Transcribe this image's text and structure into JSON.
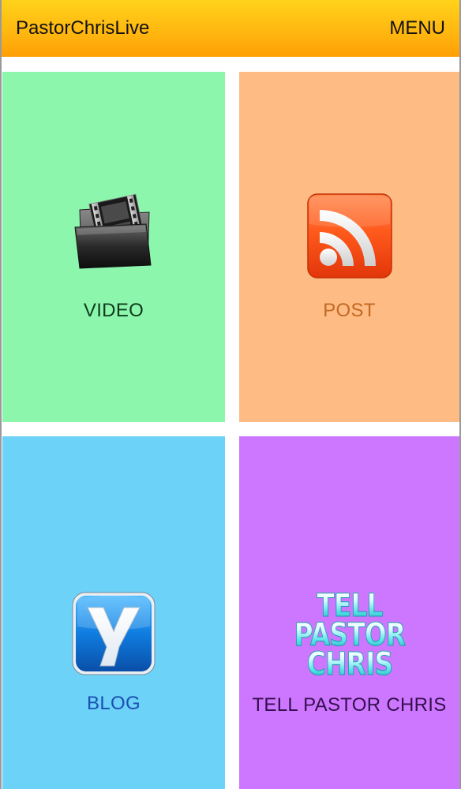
{
  "header": {
    "title": "PastorChrisLive",
    "menu_label": "MENU"
  },
  "tiles": [
    {
      "label": "VIDEO",
      "icon": "video-folder-icon",
      "background": "#8df6ad",
      "text_color": "#0f3a1c"
    },
    {
      "label": "POST",
      "icon": "rss-feed-icon",
      "background": "#ffbb84",
      "text_color": "#c26a22"
    },
    {
      "label": "BLOG",
      "icon": "blog-y-icon",
      "background": "#6dd2f7",
      "text_color": "#1b4fb3"
    },
    {
      "label": "TELL PASTOR CHRIS",
      "icon": "tell-pastor-chris-logo",
      "background": "#cd76ff",
      "text_color": "#33104d"
    }
  ],
  "tell_logo_lines": [
    "TELL",
    "PASTOR",
    "CHRIS"
  ],
  "colors": {
    "header_top": "#ffd21a",
    "header_bottom": "#ff9f05"
  }
}
